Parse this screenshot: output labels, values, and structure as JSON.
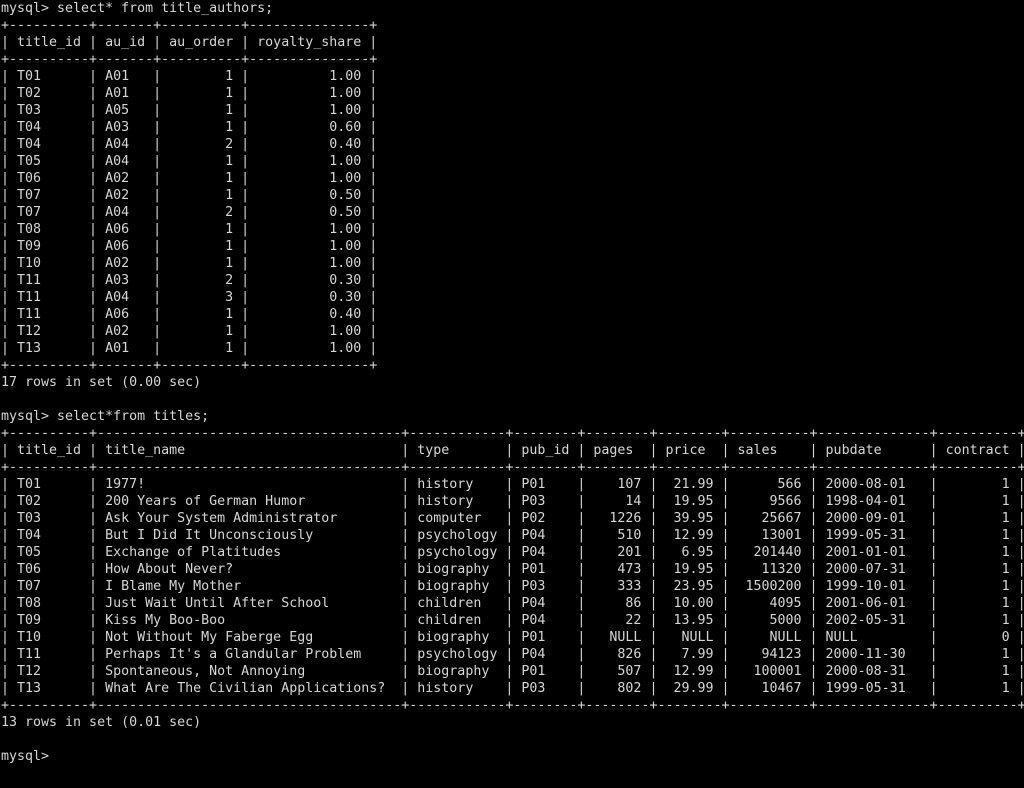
{
  "terminal": {
    "app": "mysql-client-terminal",
    "prompt": "mysql>",
    "foreground_color": "#d6d6d6",
    "background_color": "#000000"
  },
  "blocks": [
    {
      "command": "mysql> select* from title_authors;",
      "table": {
        "columns": [
          {
            "name": "title_id",
            "width": 8,
            "align": "left"
          },
          {
            "name": "au_id",
            "width": 5,
            "align": "left"
          },
          {
            "name": "au_order",
            "width": 8,
            "align": "right"
          },
          {
            "name": "royalty_share",
            "width": 13,
            "align": "right"
          }
        ],
        "rows": [
          [
            "T01",
            "A01",
            "1",
            "1.00"
          ],
          [
            "T02",
            "A01",
            "1",
            "1.00"
          ],
          [
            "T03",
            "A05",
            "1",
            "1.00"
          ],
          [
            "T04",
            "A03",
            "1",
            "0.60"
          ],
          [
            "T04",
            "A04",
            "2",
            "0.40"
          ],
          [
            "T05",
            "A04",
            "1",
            "1.00"
          ],
          [
            "T06",
            "A02",
            "1",
            "1.00"
          ],
          [
            "T07",
            "A02",
            "1",
            "0.50"
          ],
          [
            "T07",
            "A04",
            "2",
            "0.50"
          ],
          [
            "T08",
            "A06",
            "1",
            "1.00"
          ],
          [
            "T09",
            "A06",
            "1",
            "1.00"
          ],
          [
            "T10",
            "A02",
            "1",
            "1.00"
          ],
          [
            "T11",
            "A03",
            "2",
            "0.30"
          ],
          [
            "T11",
            "A04",
            "3",
            "0.30"
          ],
          [
            "T11",
            "A06",
            "1",
            "0.40"
          ],
          [
            "T12",
            "A02",
            "1",
            "1.00"
          ],
          [
            "T13",
            "A01",
            "1",
            "1.00"
          ]
        ]
      },
      "status": "17 rows in set (0.00 sec)"
    },
    {
      "command": "mysql> select*from titles;",
      "table": {
        "columns": [
          {
            "name": "title_id",
            "width": 8,
            "align": "left"
          },
          {
            "name": "title_name",
            "width": 36,
            "align": "left"
          },
          {
            "name": "type",
            "width": 10,
            "align": "left"
          },
          {
            "name": "pub_id",
            "width": 6,
            "align": "left"
          },
          {
            "name": "pages",
            "width": 6,
            "align": "right"
          },
          {
            "name": "price",
            "width": 6,
            "align": "right"
          },
          {
            "name": "sales",
            "width": 8,
            "align": "right"
          },
          {
            "name": "pubdate",
            "width": 12,
            "align": "left"
          },
          {
            "name": "contract",
            "width": 8,
            "align": "right"
          }
        ],
        "rows": [
          [
            "T01",
            "1977!",
            "history",
            "P01",
            "107",
            "21.99",
            "566",
            "2000-08-01",
            "1"
          ],
          [
            "T02",
            "200 Years of German Humor",
            "history",
            "P03",
            "14",
            "19.95",
            "9566",
            "1998-04-01",
            "1"
          ],
          [
            "T03",
            "Ask Your System Administrator",
            "computer",
            "P02",
            "1226",
            "39.95",
            "25667",
            "2000-09-01",
            "1"
          ],
          [
            "T04",
            "But I Did It Unconsciously",
            "psychology",
            "P04",
            "510",
            "12.99",
            "13001",
            "1999-05-31",
            "1"
          ],
          [
            "T05",
            "Exchange of Platitudes",
            "psychology",
            "P04",
            "201",
            "6.95",
            "201440",
            "2001-01-01",
            "1"
          ],
          [
            "T06",
            "How About Never?",
            "biography",
            "P01",
            "473",
            "19.95",
            "11320",
            "2000-07-31",
            "1"
          ],
          [
            "T07",
            "I Blame My Mother",
            "biography",
            "P03",
            "333",
            "23.95",
            "1500200",
            "1999-10-01",
            "1"
          ],
          [
            "T08",
            "Just Wait Until After School",
            "children",
            "P04",
            "86",
            "10.00",
            "4095",
            "2001-06-01",
            "1"
          ],
          [
            "T09",
            "Kiss My Boo-Boo",
            "children",
            "P04",
            "22",
            "13.95",
            "5000",
            "2002-05-31",
            "1"
          ],
          [
            "T10",
            "Not Without My Faberge Egg",
            "biography",
            "P01",
            "NULL",
            "NULL",
            "NULL",
            "NULL",
            "0"
          ],
          [
            "T11",
            "Perhaps It's a Glandular Problem",
            "psychology",
            "P04",
            "826",
            "7.99",
            "94123",
            "2000-11-30",
            "1"
          ],
          [
            "T12",
            "Spontaneous, Not Annoying",
            "biography",
            "P01",
            "507",
            "12.99",
            "100001",
            "2000-08-31",
            "1"
          ],
          [
            "T13",
            "What Are The Civilian Applications?",
            "history",
            "P03",
            "802",
            "29.99",
            "10467",
            "1999-05-31",
            "1"
          ]
        ]
      },
      "status": "13 rows in set (0.01 sec)"
    }
  ],
  "trailing_prompt": "mysql>"
}
